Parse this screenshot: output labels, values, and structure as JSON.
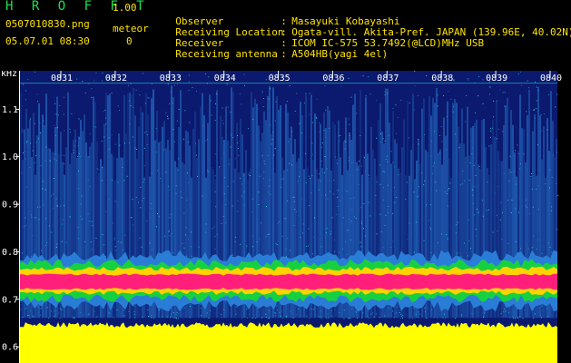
{
  "header": {
    "app_title": "H R O F F T",
    "app_version": "1.00",
    "file_name": "0507010830.png",
    "meteor_label": "meteor",
    "datetime": "05.07.01 08:30",
    "meteor_count": "0"
  },
  "info": [
    {
      "label": "Observer",
      "value": "Masayuki Kobayashi"
    },
    {
      "label": "Receiving Location",
      "value": "Ogata-vill. Akita-Pref. JAPAN (139.96E, 40.02N)"
    },
    {
      "label": "Receiver",
      "value": "ICOM IC-575 53.7492(@LCD)MHz USB"
    },
    {
      "label": "Receiving antenna",
      "value": "A504HB(yagi 4el)"
    }
  ],
  "info_separator": ":",
  "spectrogram": {
    "y_unit": "kHz",
    "y_ticks": [
      "1.1",
      "1.0",
      "0.9",
      "0.8",
      "0.7",
      "0.6"
    ],
    "y_tick_values": [
      1.1,
      1.0,
      0.9,
      0.8,
      0.7,
      0.6
    ],
    "x_ticks": [
      "0831",
      "0832",
      "0833",
      "0834",
      "0835",
      "0836",
      "0837",
      "0838",
      "0839",
      "0840"
    ],
    "colors": {
      "background": "#0b1a6e",
      "noise": "#2a7dd6",
      "speckle": "#33d0e0",
      "band_outer": "#17d040",
      "band_mid": "#ffd200",
      "band_core": "#ff1f7a",
      "floor": "#ffff00",
      "axis": "#ffffff"
    }
  }
}
